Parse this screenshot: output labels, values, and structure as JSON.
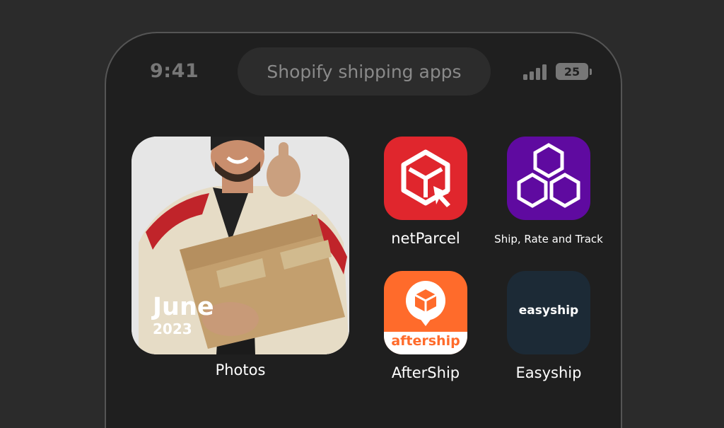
{
  "status_bar": {
    "time": "9:41",
    "battery_level": "25",
    "signal_bars": 4
  },
  "dynamic_island": {
    "text": "Shopify shipping apps"
  },
  "photos_widget": {
    "month": "June",
    "year": "2023",
    "label": "Photos"
  },
  "apps": [
    {
      "name": "netParcel",
      "icon": "netparcel-box-cursor-icon",
      "color": "#e0262d"
    },
    {
      "name": "Ship, Rate and Track",
      "icon": "hexagons-icon",
      "color": "#5f0aa0"
    },
    {
      "name": "AfterShip",
      "icon": "aftership-icon",
      "brand_text": "aftership",
      "color": "#ff6b2b"
    },
    {
      "name": "Easyship",
      "icon": "easyship-icon",
      "brand_text": "easyship",
      "color": "#1c2a36"
    }
  ]
}
